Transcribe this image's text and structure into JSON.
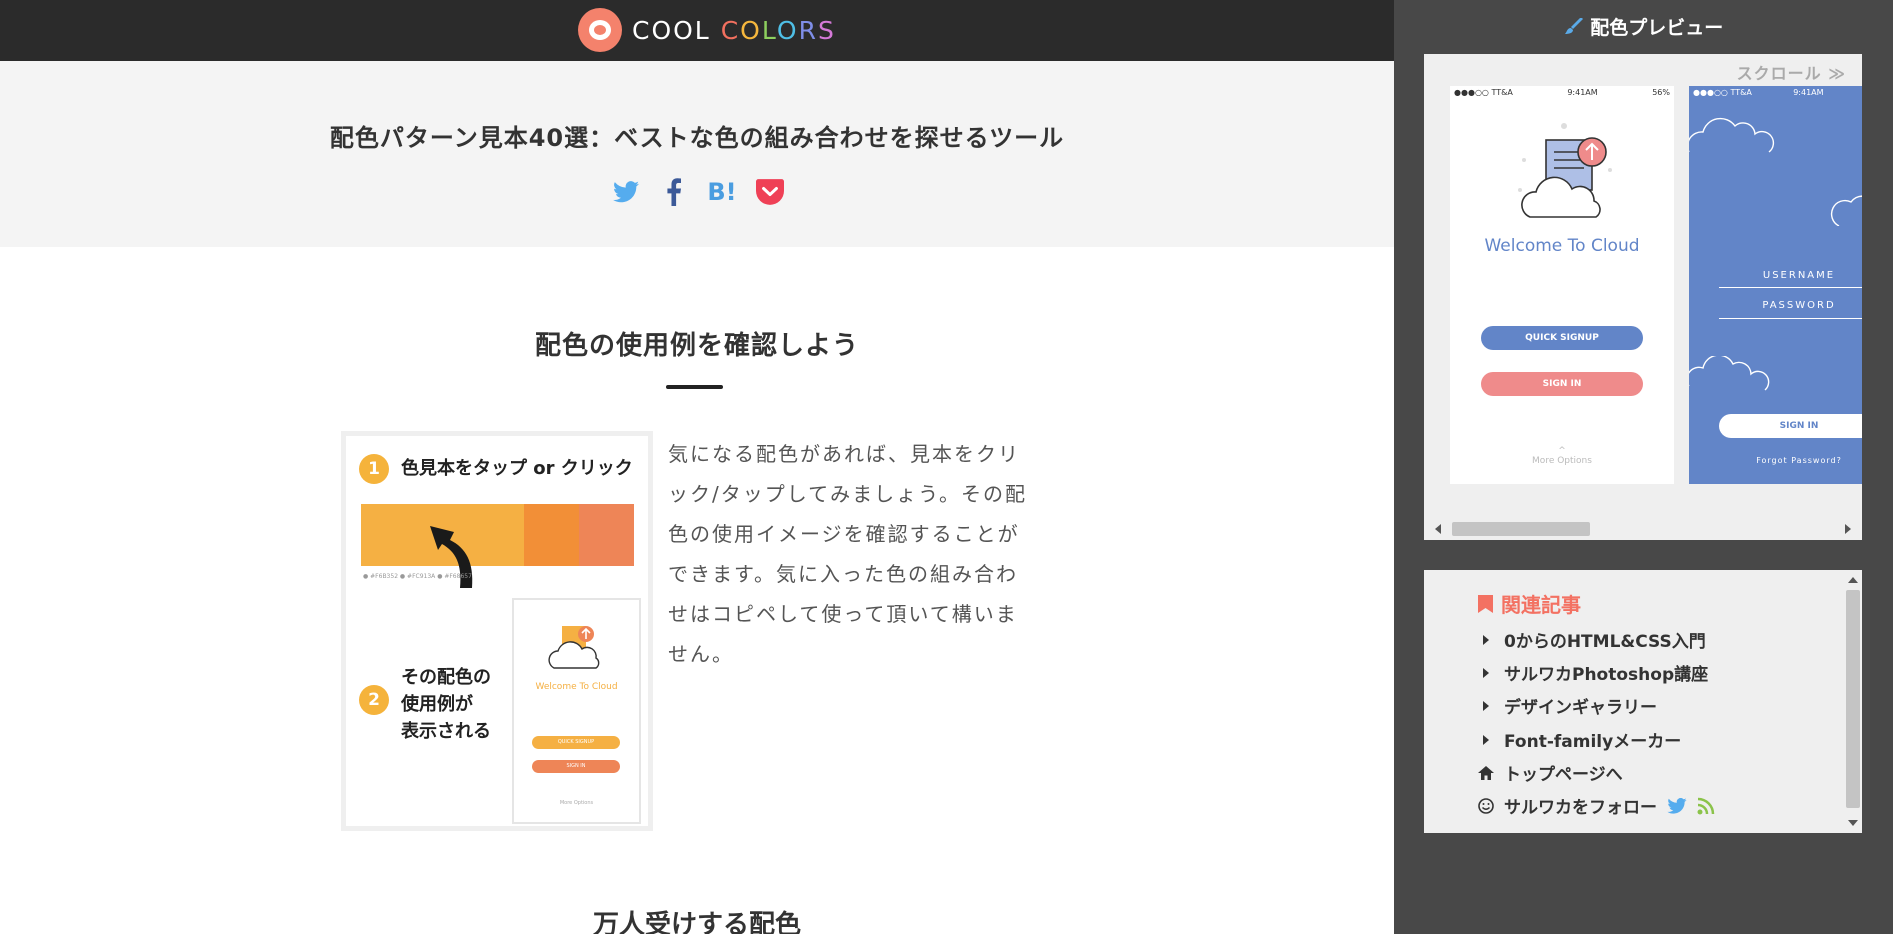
{
  "header": {
    "logo_text_1": "COOL",
    "logo_letters": [
      "C",
      "O",
      "L",
      "O",
      "R",
      "S"
    ]
  },
  "hero": {
    "title": "配色パターン見本40選：ベストな色の組み合わせを探せるツール",
    "share": [
      {
        "name": "twitter-icon",
        "color": "#55acee"
      },
      {
        "name": "facebook-icon",
        "color": "#3b5998"
      },
      {
        "name": "hatena-bookmark-icon",
        "label": "B!",
        "color": "#4a9de0"
      },
      {
        "name": "pocket-icon",
        "color": "#ef4056"
      }
    ]
  },
  "section1": {
    "title": "配色の使用例を確認しよう",
    "step1_num": "1",
    "step1_text": "色見本をタップ or クリック",
    "step2_num": "2",
    "step2_text_1": "その配色の",
    "step2_text_2": "使用例が",
    "step2_text_3": "表示される",
    "swatch_codes": "● #F6B352   ● #FC913A   ● #F68657",
    "mini_phone_title": "Welcome To Cloud",
    "mini_btn_1": "QUICK SIGNUP",
    "mini_btn_2": "SIGN IN",
    "mini_more": "More Options",
    "intro": "気になる配色があれば、見本をクリック/タップしてみましょう。その配色の使用イメージを確認することができます。気に入った色の組み合わせはコピペして使って頂いて構いません。"
  },
  "section2": {
    "title": "万人受けする配色"
  },
  "sidebar": {
    "preview_title": "配色プレビュー",
    "scroll_hint": "スクロール ≫",
    "phone1": {
      "carrier": "●●●○○ TT&A",
      "time": "9:41AM",
      "battery": "56%",
      "title": "Welcome To Cloud",
      "btn_signup": "QUICK SIGNUP",
      "btn_signin": "SIGN IN",
      "more_caret": "^",
      "more": "More Options"
    },
    "phone2": {
      "carrier": "●●●○○ TT&A",
      "time": "9:41AM",
      "username": "USERNAME",
      "password": "PASSWORD",
      "btn_signin": "SIGN IN",
      "forgot": "Forgot Password?"
    },
    "related": {
      "title": "関連記事",
      "items": [
        "0からのHTML&CSS入門",
        "サルワカPhotoshop講座",
        "デザインギャラリー",
        "Font-familyメーカー"
      ],
      "top_page": "トップページへ",
      "follow": "サルワカをフォロー"
    }
  },
  "colors": {
    "accent_coral": "#f37162",
    "phone_blue": "#6285c8",
    "phone_pink": "#ef8b8b",
    "swatch_yellow": "#f5b043"
  }
}
